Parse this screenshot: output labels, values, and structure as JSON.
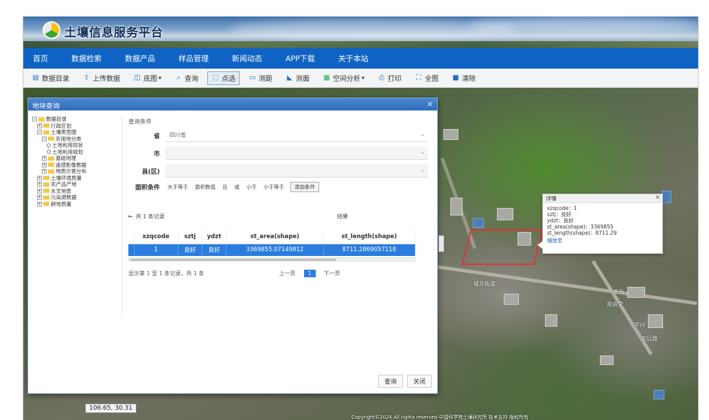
{
  "header": {
    "site_title": "土壤信息服务平台"
  },
  "nav": {
    "items": [
      "首页",
      "数据检索",
      "数据产品",
      "样品管理",
      "新闻动态",
      "APP下载",
      "关于本站"
    ]
  },
  "toolbar": {
    "items": [
      {
        "label": "数据目录",
        "icon": "catalog-icon"
      },
      {
        "label": "上传数据",
        "icon": "upload-icon"
      },
      {
        "label": "底图",
        "icon": "basemap-icon"
      },
      {
        "label": "查询",
        "icon": "search-icon"
      },
      {
        "label": "点选",
        "icon": "select-icon"
      },
      {
        "label": "测距",
        "icon": "measure-distance-icon"
      },
      {
        "label": "测面",
        "icon": "measure-area-icon"
      },
      {
        "label": "空间分析",
        "icon": "analysis-icon"
      },
      {
        "label": "打印",
        "icon": "print-icon"
      },
      {
        "label": "全图",
        "icon": "fullextent-icon"
      },
      {
        "label": "清除",
        "icon": "clear-icon"
      }
    ]
  },
  "dialog": {
    "title": "地块查询",
    "close": "×",
    "tree": [
      {
        "label": "数据目录",
        "level": 0,
        "exp": "−"
      },
      {
        "label": "行政区划",
        "level": 1,
        "exp": "+"
      },
      {
        "label": "土壤类型图",
        "level": 1,
        "exp": "−"
      },
      {
        "label": "农用地分类",
        "level": 2,
        "exp": "−"
      },
      {
        "label": "土地利用现状",
        "level": 3,
        "exp": ""
      },
      {
        "label": "土地利用规划",
        "level": 3,
        "exp": ""
      },
      {
        "label": "基础地理",
        "level": 2,
        "exp": "+"
      },
      {
        "label": "遥感影像数据",
        "level": 2,
        "exp": "+"
      },
      {
        "label": "地质灾害分布",
        "level": 2,
        "exp": "+"
      },
      {
        "label": "土壤环境质量",
        "level": 1,
        "exp": "+"
      },
      {
        "label": "农产品产地",
        "level": 1,
        "exp": "+"
      },
      {
        "label": "水文地质",
        "level": 1,
        "exp": "+"
      },
      {
        "label": "污染源数据",
        "level": 1,
        "exp": "+"
      },
      {
        "label": "耕地质量",
        "level": 1,
        "exp": "+"
      }
    ],
    "query": {
      "legend": "查询条件",
      "fields": [
        {
          "label": "省",
          "value": "四川省",
          "disabled": false
        },
        {
          "label": "市",
          "value": "",
          "disabled": true
        },
        {
          "label": "县(区)",
          "value": "",
          "disabled": true
        }
      ],
      "condition_label": "面积条件",
      "condition_options": [
        "大于等于",
        "面积数值",
        "且",
        "或",
        "小于",
        "小于等于"
      ],
      "condition_button": "添加条件"
    },
    "result": {
      "count": "共 1 条记录",
      "title": "结果"
    },
    "table": {
      "columns": [
        "xzqcode",
        "sztj",
        "ydzt",
        "st_area(shape)",
        "st_length(shape)"
      ],
      "rows": [
        [
          "1",
          "良好",
          "良好",
          "3369855.07149812",
          "8711.2869057118"
        ]
      ]
    },
    "pager": {
      "info": "显示第 1 至 1 条记录，共 1 条",
      "prev": "上一页",
      "page": "1",
      "next": "下一页"
    },
    "footer": {
      "query": "查询",
      "close": "关闭"
    }
  },
  "popup": {
    "title": "详情",
    "close": "×",
    "lines": [
      "xzqcode：1",
      "sztj：良好",
      "ydzt：良好",
      "st_area(shape)：3369855",
      "st_length(shape)：8711.29"
    ],
    "link": "缩放至"
  },
  "map": {
    "labels": [
      "城北街道",
      "新街",
      "华兴",
      "宏远路",
      "观音堂"
    ],
    "coords": "106.65, 30.31",
    "copyright": "Copyright©2024 All rights reserved 中国科学院土壤研究所 技术支持 版权所有"
  }
}
